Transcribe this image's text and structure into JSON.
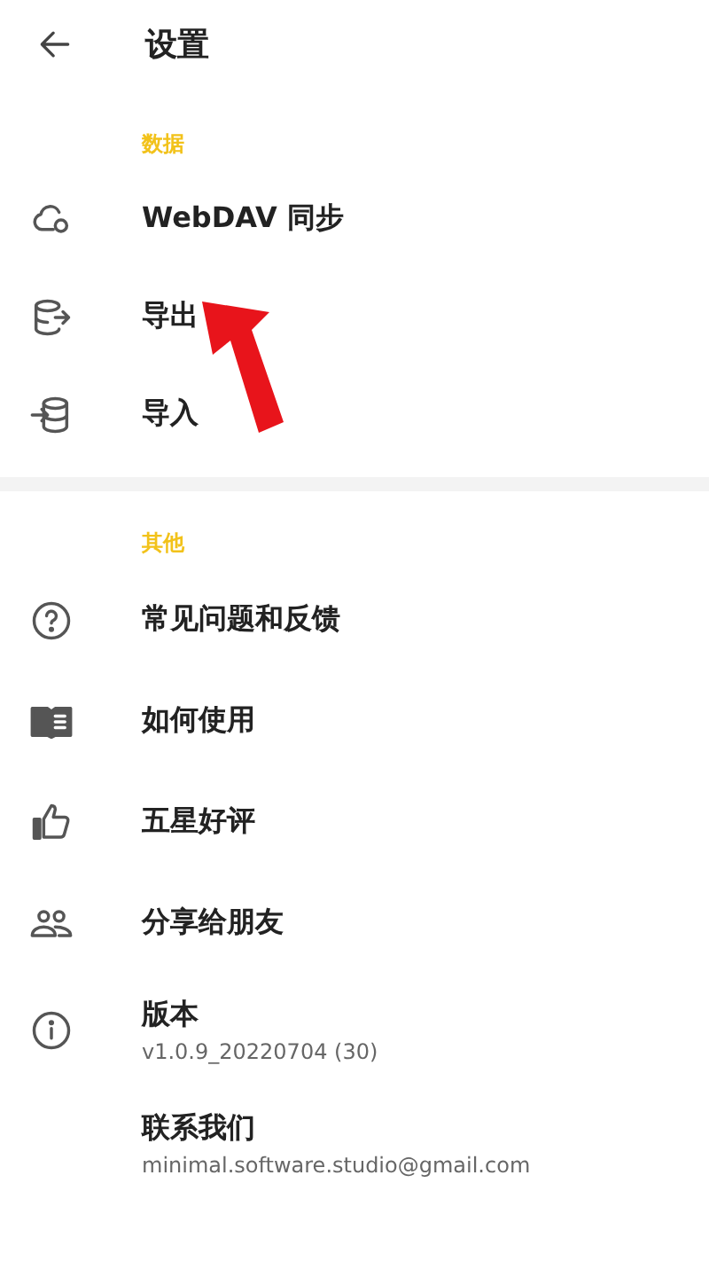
{
  "header": {
    "title": "设置"
  },
  "sections": [
    {
      "title": "数据",
      "items": [
        {
          "label": "WebDAV 同步"
        },
        {
          "label": "导出"
        },
        {
          "label": "导入"
        }
      ]
    },
    {
      "title": "其他",
      "items": [
        {
          "label": "常见问题和反馈"
        },
        {
          "label": "如何使用"
        },
        {
          "label": "五星好评"
        },
        {
          "label": "分享给朋友"
        },
        {
          "label": "版本",
          "subtitle": "v1.0.9_20220704 (30)"
        },
        {
          "label": "联系我们",
          "subtitle": "minimal.software.studio@gmail.com"
        }
      ]
    }
  ]
}
